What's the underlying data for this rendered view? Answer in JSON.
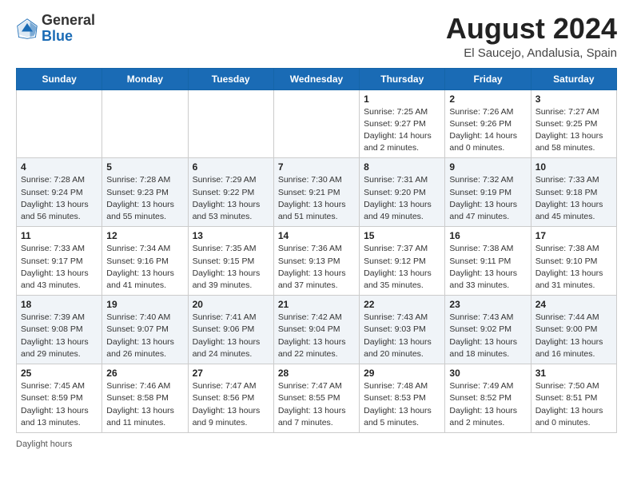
{
  "header": {
    "logo_general": "General",
    "logo_blue": "Blue",
    "month_title": "August 2024",
    "location": "El Saucejo, Andalusia, Spain"
  },
  "weekdays": [
    "Sunday",
    "Monday",
    "Tuesday",
    "Wednesday",
    "Thursday",
    "Friday",
    "Saturday"
  ],
  "weeks": [
    [
      {
        "day": "",
        "info": ""
      },
      {
        "day": "",
        "info": ""
      },
      {
        "day": "",
        "info": ""
      },
      {
        "day": "",
        "info": ""
      },
      {
        "day": "1",
        "info": "Sunrise: 7:25 AM\nSunset: 9:27 PM\nDaylight: 14 hours\nand 2 minutes."
      },
      {
        "day": "2",
        "info": "Sunrise: 7:26 AM\nSunset: 9:26 PM\nDaylight: 14 hours\nand 0 minutes."
      },
      {
        "day": "3",
        "info": "Sunrise: 7:27 AM\nSunset: 9:25 PM\nDaylight: 13 hours\nand 58 minutes."
      }
    ],
    [
      {
        "day": "4",
        "info": "Sunrise: 7:28 AM\nSunset: 9:24 PM\nDaylight: 13 hours\nand 56 minutes."
      },
      {
        "day": "5",
        "info": "Sunrise: 7:28 AM\nSunset: 9:23 PM\nDaylight: 13 hours\nand 55 minutes."
      },
      {
        "day": "6",
        "info": "Sunrise: 7:29 AM\nSunset: 9:22 PM\nDaylight: 13 hours\nand 53 minutes."
      },
      {
        "day": "7",
        "info": "Sunrise: 7:30 AM\nSunset: 9:21 PM\nDaylight: 13 hours\nand 51 minutes."
      },
      {
        "day": "8",
        "info": "Sunrise: 7:31 AM\nSunset: 9:20 PM\nDaylight: 13 hours\nand 49 minutes."
      },
      {
        "day": "9",
        "info": "Sunrise: 7:32 AM\nSunset: 9:19 PM\nDaylight: 13 hours\nand 47 minutes."
      },
      {
        "day": "10",
        "info": "Sunrise: 7:33 AM\nSunset: 9:18 PM\nDaylight: 13 hours\nand 45 minutes."
      }
    ],
    [
      {
        "day": "11",
        "info": "Sunrise: 7:33 AM\nSunset: 9:17 PM\nDaylight: 13 hours\nand 43 minutes."
      },
      {
        "day": "12",
        "info": "Sunrise: 7:34 AM\nSunset: 9:16 PM\nDaylight: 13 hours\nand 41 minutes."
      },
      {
        "day": "13",
        "info": "Sunrise: 7:35 AM\nSunset: 9:15 PM\nDaylight: 13 hours\nand 39 minutes."
      },
      {
        "day": "14",
        "info": "Sunrise: 7:36 AM\nSunset: 9:13 PM\nDaylight: 13 hours\nand 37 minutes."
      },
      {
        "day": "15",
        "info": "Sunrise: 7:37 AM\nSunset: 9:12 PM\nDaylight: 13 hours\nand 35 minutes."
      },
      {
        "day": "16",
        "info": "Sunrise: 7:38 AM\nSunset: 9:11 PM\nDaylight: 13 hours\nand 33 minutes."
      },
      {
        "day": "17",
        "info": "Sunrise: 7:38 AM\nSunset: 9:10 PM\nDaylight: 13 hours\nand 31 minutes."
      }
    ],
    [
      {
        "day": "18",
        "info": "Sunrise: 7:39 AM\nSunset: 9:08 PM\nDaylight: 13 hours\nand 29 minutes."
      },
      {
        "day": "19",
        "info": "Sunrise: 7:40 AM\nSunset: 9:07 PM\nDaylight: 13 hours\nand 26 minutes."
      },
      {
        "day": "20",
        "info": "Sunrise: 7:41 AM\nSunset: 9:06 PM\nDaylight: 13 hours\nand 24 minutes."
      },
      {
        "day": "21",
        "info": "Sunrise: 7:42 AM\nSunset: 9:04 PM\nDaylight: 13 hours\nand 22 minutes."
      },
      {
        "day": "22",
        "info": "Sunrise: 7:43 AM\nSunset: 9:03 PM\nDaylight: 13 hours\nand 20 minutes."
      },
      {
        "day": "23",
        "info": "Sunrise: 7:43 AM\nSunset: 9:02 PM\nDaylight: 13 hours\nand 18 minutes."
      },
      {
        "day": "24",
        "info": "Sunrise: 7:44 AM\nSunset: 9:00 PM\nDaylight: 13 hours\nand 16 minutes."
      }
    ],
    [
      {
        "day": "25",
        "info": "Sunrise: 7:45 AM\nSunset: 8:59 PM\nDaylight: 13 hours\nand 13 minutes."
      },
      {
        "day": "26",
        "info": "Sunrise: 7:46 AM\nSunset: 8:58 PM\nDaylight: 13 hours\nand 11 minutes."
      },
      {
        "day": "27",
        "info": "Sunrise: 7:47 AM\nSunset: 8:56 PM\nDaylight: 13 hours\nand 9 minutes."
      },
      {
        "day": "28",
        "info": "Sunrise: 7:47 AM\nSunset: 8:55 PM\nDaylight: 13 hours\nand 7 minutes."
      },
      {
        "day": "29",
        "info": "Sunrise: 7:48 AM\nSunset: 8:53 PM\nDaylight: 13 hours\nand 5 minutes."
      },
      {
        "day": "30",
        "info": "Sunrise: 7:49 AM\nSunset: 8:52 PM\nDaylight: 13 hours\nand 2 minutes."
      },
      {
        "day": "31",
        "info": "Sunrise: 7:50 AM\nSunset: 8:51 PM\nDaylight: 13 hours\nand 0 minutes."
      }
    ]
  ],
  "footer": {
    "daylight_label": "Daylight hours"
  }
}
